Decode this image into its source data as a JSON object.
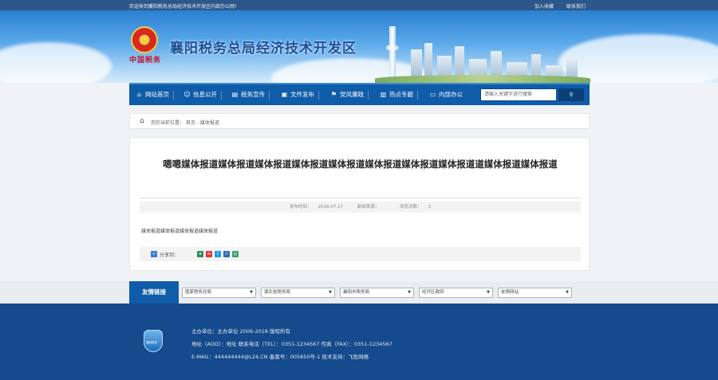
{
  "topbar": {
    "welcome": "欢迎来到襄阳税务总局经济技术开发区内部办公网！",
    "add_favorite": "加入收藏",
    "contact_us": "联系我们"
  },
  "header": {
    "title": "襄阳税务总局经济技术开发区",
    "tax_text": "中国税务"
  },
  "nav": {
    "items": [
      {
        "label": "网站首页",
        "icon": "home-icon"
      },
      {
        "label": "信息公开",
        "icon": "chat-icon"
      },
      {
        "label": "税务宣传",
        "icon": "print-icon"
      },
      {
        "label": "文件发布",
        "icon": "file-icon"
      },
      {
        "label": "党风廉政",
        "icon": "flag-icon"
      },
      {
        "label": "热点专题",
        "icon": "book-icon"
      },
      {
        "label": "内部办公",
        "icon": "briefcase-icon"
      }
    ],
    "search_placeholder": "请输入关键字进行搜索",
    "search_button": "搜索"
  },
  "breadcrumb": {
    "text": "您的当前位置： 首页 - 媒体报道"
  },
  "article": {
    "title": "嗯嗯媒体报道媒体报道媒体报道媒体报道媒体报道媒体报道媒体报道媒体报道道媒体报道媒体报道",
    "publish_label": "发布时间：",
    "publish_date": "2018.07.17",
    "source_label": "新闻来源：",
    "source": "",
    "views_label": "浏览次数：",
    "views": "3",
    "body": "媒体报道媒体报道媒体报道媒体报道",
    "share_label": "分享到："
  },
  "friend_links": {
    "label": "友情链接",
    "selects": [
      "国家税务总局",
      "湖北省税务局",
      "襄阳市税务局",
      "经开区政府",
      "友情网站"
    ]
  },
  "footer": {
    "line1": "主办单位：主办单位    2006-2018  版权所有",
    "line2": "地址（ADD）：地址    联系电话（TEL）：0351-1234567    传真（FAX）：0351-1234567",
    "line3": "E-MAIL：444444444@L24.CN    备案号：005850号-1    技术支持：飞鱼网络",
    "logo_text": "襄阳税务"
  },
  "colors": {
    "nav_blue": "#0f5ca8",
    "footer_blue": "#154a8c",
    "title_blue": "#1d4f97",
    "emblem_red": "#d42a1f"
  }
}
